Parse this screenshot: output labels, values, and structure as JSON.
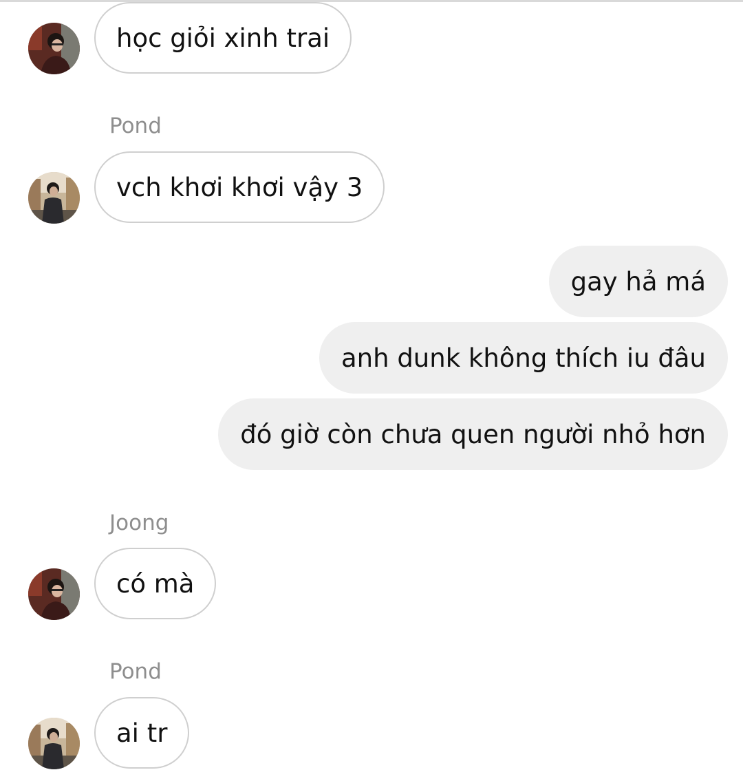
{
  "conversation": {
    "messages": [
      {
        "sender": "",
        "text": "học giỏi xinh trai",
        "direction": "incoming",
        "avatar": "avatar-joong"
      },
      {
        "sender": "Pond",
        "text": "vch khơi khơi vậy 3",
        "direction": "incoming",
        "avatar": "avatar-pond"
      },
      {
        "sender": "",
        "text": "gay hả má",
        "direction": "outgoing"
      },
      {
        "sender": "",
        "text": "anh dunk không thích iu đâu",
        "direction": "outgoing"
      },
      {
        "sender": "",
        "text": "đó giờ còn chưa quen người nhỏ hơn",
        "direction": "outgoing"
      },
      {
        "sender": "Joong",
        "text": "có mà",
        "direction": "incoming",
        "avatar": "avatar-joong"
      },
      {
        "sender": "Pond",
        "text": "ai tr",
        "direction": "incoming",
        "avatar": "avatar-pond"
      }
    ]
  },
  "colors": {
    "incoming_bubble_border": "#cfcfcf",
    "outgoing_bubble_bg": "#efefef",
    "sender_name": "#8e8e8e"
  }
}
